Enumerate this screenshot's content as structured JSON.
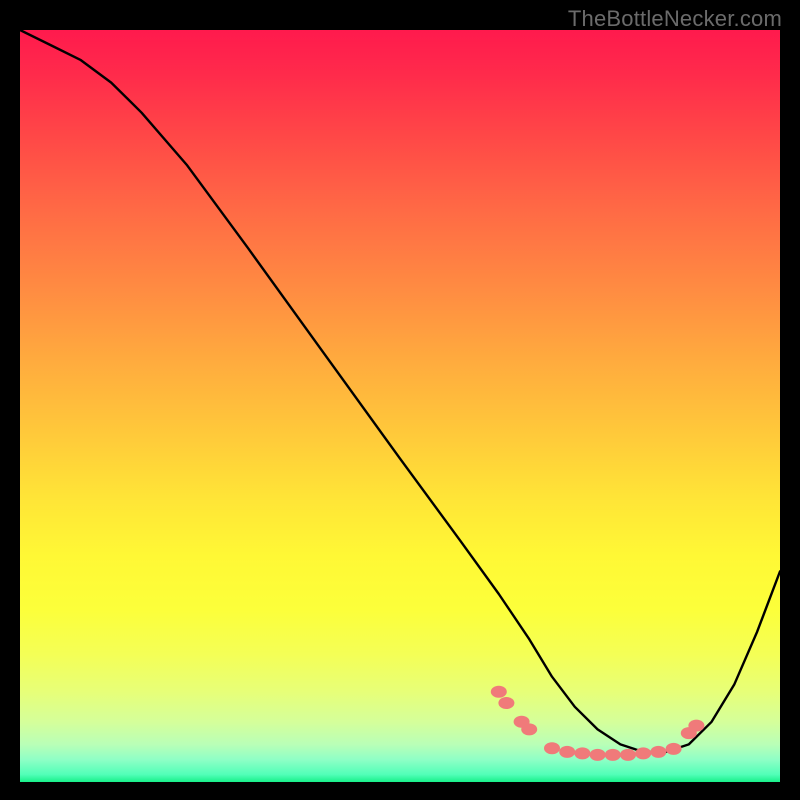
{
  "watermark": {
    "text": "TheBottleNecker.com"
  },
  "colors": {
    "background": "#000000",
    "curve": "#000000",
    "bead": "#f07a7a",
    "watermark": "#6b6b6b"
  },
  "chart_data": {
    "type": "line",
    "title": "",
    "xlabel": "",
    "ylabel": "",
    "xlim": [
      0,
      100
    ],
    "ylim": [
      0,
      100
    ],
    "grid": false,
    "legend": false,
    "series": [
      {
        "name": "curve",
        "x": [
          0,
          4,
          8,
          12,
          16,
          22,
          30,
          40,
          50,
          58,
          63,
          67,
          70,
          73,
          76,
          79,
          82,
          85,
          88,
          91,
          94,
          97,
          100
        ],
        "y": [
          100,
          98,
          96,
          93,
          89,
          82,
          71,
          57,
          43,
          32,
          25,
          19,
          14,
          10,
          7,
          5,
          4,
          4,
          5,
          8,
          13,
          20,
          28
        ]
      }
    ],
    "markers": [
      {
        "name": "bead-1",
        "x": 63,
        "y": 12.0
      },
      {
        "name": "bead-2",
        "x": 64,
        "y": 10.5
      },
      {
        "name": "bead-3",
        "x": 66,
        "y": 8.0
      },
      {
        "name": "bead-4",
        "x": 67,
        "y": 7.0
      },
      {
        "name": "bead-5",
        "x": 70,
        "y": 4.5
      },
      {
        "name": "bead-6",
        "x": 72,
        "y": 4.0
      },
      {
        "name": "bead-7",
        "x": 74,
        "y": 3.8
      },
      {
        "name": "bead-8",
        "x": 76,
        "y": 3.6
      },
      {
        "name": "bead-9",
        "x": 78,
        "y": 3.6
      },
      {
        "name": "bead-10",
        "x": 80,
        "y": 3.6
      },
      {
        "name": "bead-11",
        "x": 82,
        "y": 3.8
      },
      {
        "name": "bead-12",
        "x": 84,
        "y": 4.0
      },
      {
        "name": "bead-13",
        "x": 86,
        "y": 4.4
      },
      {
        "name": "bead-14",
        "x": 88,
        "y": 6.5
      },
      {
        "name": "bead-15",
        "x": 89,
        "y": 7.5
      }
    ],
    "gradient_stops": [
      {
        "pos": 0,
        "color": "#ff1a4d"
      },
      {
        "pos": 50,
        "color": "#ffca3a"
      },
      {
        "pos": 80,
        "color": "#fcff3a"
      },
      {
        "pos": 100,
        "color": "#18f08a"
      }
    ]
  }
}
